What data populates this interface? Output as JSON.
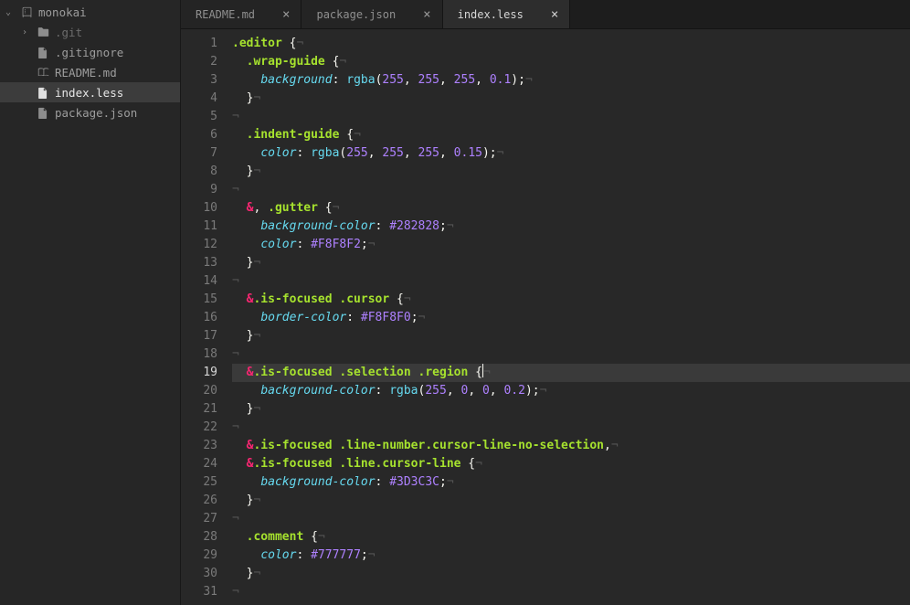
{
  "project": {
    "name": "monokai",
    "items": [
      {
        "label": ".git",
        "type": "folder",
        "expandable": true
      },
      {
        "label": ".gitignore",
        "type": "file"
      },
      {
        "label": "README.md",
        "type": "readme"
      },
      {
        "label": "index.less",
        "type": "file",
        "active": true
      },
      {
        "label": "package.json",
        "type": "file"
      }
    ]
  },
  "tabs": [
    {
      "label": "README.md",
      "active": false
    },
    {
      "label": "package.json",
      "active": false
    },
    {
      "label": "index.less",
      "active": true
    }
  ],
  "current_line": 19,
  "code_lines": [
    [
      {
        "t": "sel",
        "v": ".editor"
      },
      {
        "t": "punc",
        "v": " {"
      },
      {
        "t": "invis",
        "v": "¬"
      }
    ],
    [
      {
        "t": "indent",
        "v": "  "
      },
      {
        "t": "sel",
        "v": ".wrap-guide"
      },
      {
        "t": "punc",
        "v": " {"
      },
      {
        "t": "invis",
        "v": "¬"
      }
    ],
    [
      {
        "t": "indent",
        "v": "    "
      },
      {
        "t": "prop",
        "v": "background"
      },
      {
        "t": "punc",
        "v": ": "
      },
      {
        "t": "fn",
        "v": "rgba"
      },
      {
        "t": "punc",
        "v": "("
      },
      {
        "t": "num",
        "v": "255"
      },
      {
        "t": "punc",
        "v": ", "
      },
      {
        "t": "num",
        "v": "255"
      },
      {
        "t": "punc",
        "v": ", "
      },
      {
        "t": "num",
        "v": "255"
      },
      {
        "t": "punc",
        "v": ", "
      },
      {
        "t": "num",
        "v": "0.1"
      },
      {
        "t": "punc",
        "v": ");"
      },
      {
        "t": "invis",
        "v": "¬"
      }
    ],
    [
      {
        "t": "indent",
        "v": "  "
      },
      {
        "t": "punc",
        "v": "}"
      },
      {
        "t": "invis",
        "v": "¬"
      }
    ],
    [
      {
        "t": "invis",
        "v": "¬"
      }
    ],
    [
      {
        "t": "indent",
        "v": "  "
      },
      {
        "t": "sel",
        "v": ".indent-guide"
      },
      {
        "t": "punc",
        "v": " {"
      },
      {
        "t": "invis",
        "v": "¬"
      }
    ],
    [
      {
        "t": "indent",
        "v": "    "
      },
      {
        "t": "prop",
        "v": "color"
      },
      {
        "t": "punc",
        "v": ": "
      },
      {
        "t": "fn",
        "v": "rgba"
      },
      {
        "t": "punc",
        "v": "("
      },
      {
        "t": "num",
        "v": "255"
      },
      {
        "t": "punc",
        "v": ", "
      },
      {
        "t": "num",
        "v": "255"
      },
      {
        "t": "punc",
        "v": ", "
      },
      {
        "t": "num",
        "v": "255"
      },
      {
        "t": "punc",
        "v": ", "
      },
      {
        "t": "num",
        "v": "0.15"
      },
      {
        "t": "punc",
        "v": ");"
      },
      {
        "t": "invis",
        "v": "¬"
      }
    ],
    [
      {
        "t": "indent",
        "v": "  "
      },
      {
        "t": "punc",
        "v": "}"
      },
      {
        "t": "invis",
        "v": "¬"
      }
    ],
    [
      {
        "t": "invis",
        "v": "¬"
      }
    ],
    [
      {
        "t": "indent",
        "v": "  "
      },
      {
        "t": "amp",
        "v": "&"
      },
      {
        "t": "punc",
        "v": ", "
      },
      {
        "t": "sel",
        "v": ".gutter"
      },
      {
        "t": "punc",
        "v": " {"
      },
      {
        "t": "invis",
        "v": "¬"
      }
    ],
    [
      {
        "t": "indent",
        "v": "    "
      },
      {
        "t": "prop",
        "v": "background-color"
      },
      {
        "t": "punc",
        "v": ": "
      },
      {
        "t": "hex",
        "v": "#282828"
      },
      {
        "t": "punc",
        "v": ";"
      },
      {
        "t": "invis",
        "v": "¬"
      }
    ],
    [
      {
        "t": "indent",
        "v": "    "
      },
      {
        "t": "prop",
        "v": "color"
      },
      {
        "t": "punc",
        "v": ": "
      },
      {
        "t": "hex",
        "v": "#F8F8F2"
      },
      {
        "t": "punc",
        "v": ";"
      },
      {
        "t": "invis",
        "v": "¬"
      }
    ],
    [
      {
        "t": "indent",
        "v": "  "
      },
      {
        "t": "punc",
        "v": "}"
      },
      {
        "t": "invis",
        "v": "¬"
      }
    ],
    [
      {
        "t": "invis",
        "v": "¬"
      }
    ],
    [
      {
        "t": "indent",
        "v": "  "
      },
      {
        "t": "amp",
        "v": "&"
      },
      {
        "t": "sel",
        "v": ".is-focused"
      },
      {
        "t": "punc",
        "v": " "
      },
      {
        "t": "sel",
        "v": ".cursor"
      },
      {
        "t": "punc",
        "v": " {"
      },
      {
        "t": "invis",
        "v": "¬"
      }
    ],
    [
      {
        "t": "indent",
        "v": "    "
      },
      {
        "t": "prop",
        "v": "border-color"
      },
      {
        "t": "punc",
        "v": ": "
      },
      {
        "t": "hex",
        "v": "#F8F8F0"
      },
      {
        "t": "punc",
        "v": ";"
      },
      {
        "t": "invis",
        "v": "¬"
      }
    ],
    [
      {
        "t": "indent",
        "v": "  "
      },
      {
        "t": "punc",
        "v": "}"
      },
      {
        "t": "invis",
        "v": "¬"
      }
    ],
    [
      {
        "t": "invis",
        "v": "¬"
      }
    ],
    [
      {
        "t": "indent",
        "v": "  "
      },
      {
        "t": "amp",
        "v": "&"
      },
      {
        "t": "sel",
        "v": ".is-focused"
      },
      {
        "t": "punc",
        "v": " "
      },
      {
        "t": "sel",
        "v": ".selection"
      },
      {
        "t": "punc",
        "v": " "
      },
      {
        "t": "sel",
        "v": ".region"
      },
      {
        "t": "punc",
        "v": " {"
      },
      {
        "t": "cursor",
        "v": ""
      },
      {
        "t": "invis",
        "v": "¬"
      }
    ],
    [
      {
        "t": "indent",
        "v": "    "
      },
      {
        "t": "prop",
        "v": "background-color"
      },
      {
        "t": "punc",
        "v": ": "
      },
      {
        "t": "fn",
        "v": "rgba"
      },
      {
        "t": "punc",
        "v": "("
      },
      {
        "t": "num",
        "v": "255"
      },
      {
        "t": "punc",
        "v": ", "
      },
      {
        "t": "num",
        "v": "0"
      },
      {
        "t": "punc",
        "v": ", "
      },
      {
        "t": "num",
        "v": "0"
      },
      {
        "t": "punc",
        "v": ", "
      },
      {
        "t": "num",
        "v": "0.2"
      },
      {
        "t": "punc",
        "v": ");"
      },
      {
        "t": "invis",
        "v": "¬"
      }
    ],
    [
      {
        "t": "indent",
        "v": "  "
      },
      {
        "t": "punc",
        "v": "}"
      },
      {
        "t": "invis",
        "v": "¬"
      }
    ],
    [
      {
        "t": "invis",
        "v": "¬"
      }
    ],
    [
      {
        "t": "indent",
        "v": "  "
      },
      {
        "t": "amp",
        "v": "&"
      },
      {
        "t": "sel",
        "v": ".is-focused"
      },
      {
        "t": "punc",
        "v": " "
      },
      {
        "t": "sel",
        "v": ".line-number"
      },
      {
        "t": "sel",
        "v": ".cursor-line-no-selection"
      },
      {
        "t": "punc",
        "v": ","
      },
      {
        "t": "invis",
        "v": "¬"
      }
    ],
    [
      {
        "t": "indent",
        "v": "  "
      },
      {
        "t": "amp",
        "v": "&"
      },
      {
        "t": "sel",
        "v": ".is-focused"
      },
      {
        "t": "punc",
        "v": " "
      },
      {
        "t": "sel",
        "v": ".line"
      },
      {
        "t": "sel",
        "v": ".cursor-line"
      },
      {
        "t": "punc",
        "v": " {"
      },
      {
        "t": "invis",
        "v": "¬"
      }
    ],
    [
      {
        "t": "indent",
        "v": "    "
      },
      {
        "t": "prop",
        "v": "background-color"
      },
      {
        "t": "punc",
        "v": ": "
      },
      {
        "t": "hex",
        "v": "#3D3C3C"
      },
      {
        "t": "punc",
        "v": ";"
      },
      {
        "t": "invis",
        "v": "¬"
      }
    ],
    [
      {
        "t": "indent",
        "v": "  "
      },
      {
        "t": "punc",
        "v": "}"
      },
      {
        "t": "invis",
        "v": "¬"
      }
    ],
    [
      {
        "t": "invis",
        "v": "¬"
      }
    ],
    [
      {
        "t": "indent",
        "v": "  "
      },
      {
        "t": "sel",
        "v": ".comment"
      },
      {
        "t": "punc",
        "v": " {"
      },
      {
        "t": "invis",
        "v": "¬"
      }
    ],
    [
      {
        "t": "indent",
        "v": "    "
      },
      {
        "t": "prop",
        "v": "color"
      },
      {
        "t": "punc",
        "v": ": "
      },
      {
        "t": "hex",
        "v": "#777777"
      },
      {
        "t": "punc",
        "v": ";"
      },
      {
        "t": "invis",
        "v": "¬"
      }
    ],
    [
      {
        "t": "indent",
        "v": "  "
      },
      {
        "t": "punc",
        "v": "}"
      },
      {
        "t": "invis",
        "v": "¬"
      }
    ],
    [
      {
        "t": "invis",
        "v": "¬"
      }
    ]
  ]
}
